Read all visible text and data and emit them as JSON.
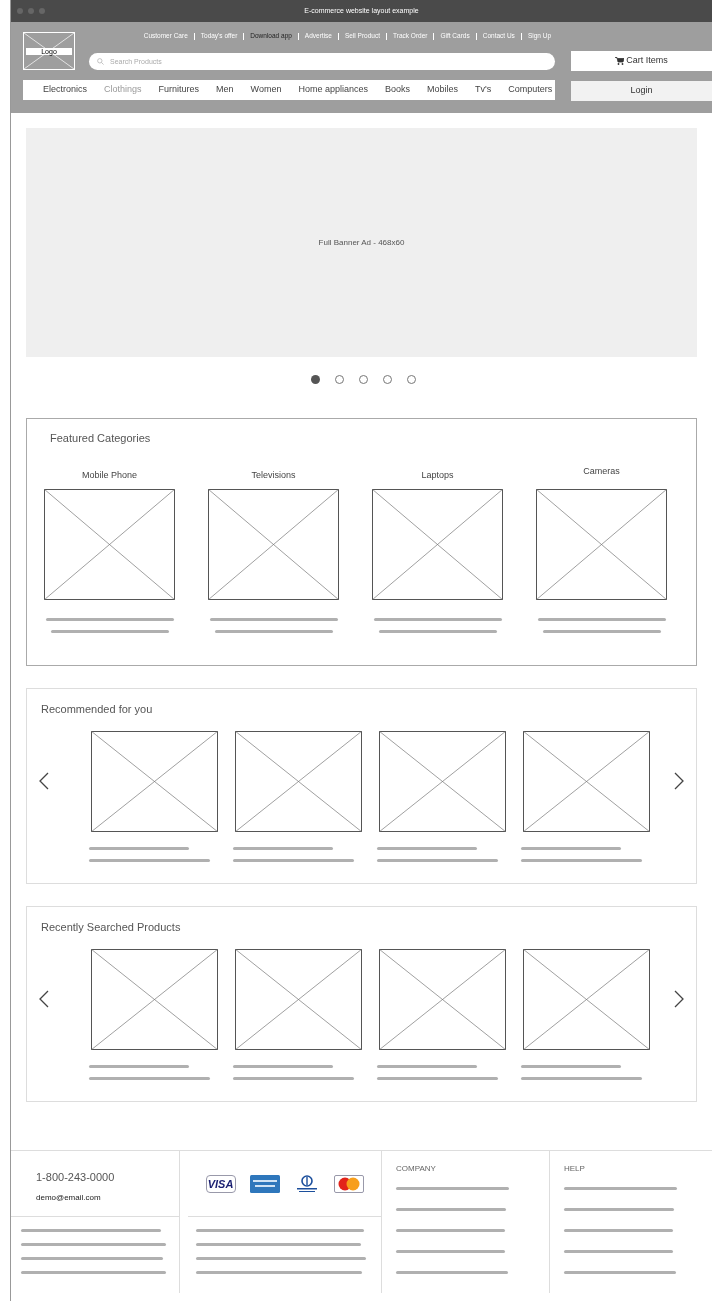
{
  "window": {
    "title": "E-commerce website layout example"
  },
  "header": {
    "logo": "Logo",
    "top_links": [
      {
        "label": "Customer Care",
        "selected": false
      },
      {
        "label": "Today's offer",
        "selected": false
      },
      {
        "label": "Download app",
        "selected": true
      },
      {
        "label": "Advertise",
        "selected": false
      },
      {
        "label": "Sell Product",
        "selected": false
      },
      {
        "label": "Track Order",
        "selected": false
      },
      {
        "label": "Gift Cards",
        "selected": false
      },
      {
        "label": "Contact Us",
        "selected": false
      },
      {
        "label": "Sign Up",
        "selected": false
      }
    ],
    "search": {
      "placeholder": "Search Products"
    },
    "cart_button": "Cart Items",
    "login_button": "Login",
    "nav": [
      {
        "label": "Electronics",
        "selected": false
      },
      {
        "label": "Clothings",
        "selected": true
      },
      {
        "label": "Furnitures",
        "selected": false
      },
      {
        "label": "Men",
        "selected": false
      },
      {
        "label": "Women",
        "selected": false
      },
      {
        "label": "Home appliances",
        "selected": false
      },
      {
        "label": "Books",
        "selected": false
      },
      {
        "label": "Mobiles",
        "selected": false
      },
      {
        "label": "Tv's",
        "selected": false
      },
      {
        "label": "Computers",
        "selected": false
      }
    ]
  },
  "banner": {
    "text": "Full Banner Ad - 468x60",
    "slides": [
      {
        "selected": true
      },
      {
        "selected": false
      },
      {
        "selected": false
      },
      {
        "selected": false
      },
      {
        "selected": false
      }
    ]
  },
  "featured": {
    "title": "Featured Categories",
    "items": [
      {
        "label": "Mobile Phone"
      },
      {
        "label": "Televisions"
      },
      {
        "label": "Laptops"
      },
      {
        "label": "Cameras"
      }
    ]
  },
  "carousels": [
    {
      "title": "Recommended for you"
    },
    {
      "title": "Recently Searched Products"
    }
  ],
  "footer": {
    "phone": "1-800-243-0000",
    "email": "demo@email.com",
    "cards": [
      {
        "kind": "visa",
        "label": "VISA"
      },
      {
        "kind": "amex"
      },
      {
        "kind": "diners"
      },
      {
        "kind": "mastercard"
      }
    ],
    "columns": [
      {
        "title": "COMPANY"
      },
      {
        "title": "HELP"
      }
    ]
  }
}
